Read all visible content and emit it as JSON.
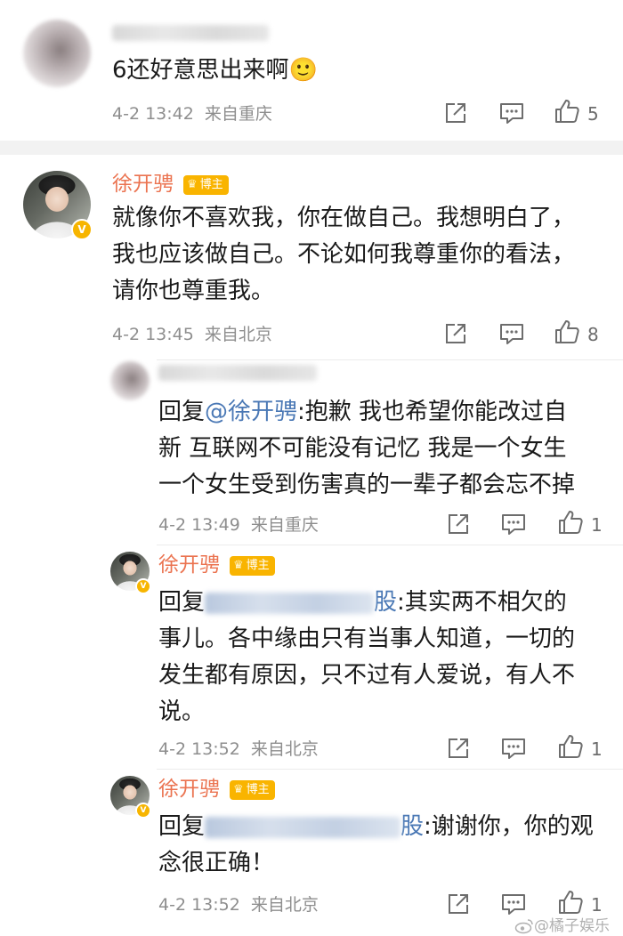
{
  "comments": [
    {
      "user": {
        "name": "",
        "blurred": true
      },
      "text_lines": [
        "6还好意思出来啊"
      ],
      "emoji": "🙂",
      "time": "4-2 13:42",
      "location": "来自重庆",
      "likes": "5"
    },
    {
      "user": {
        "name": "徐开骋",
        "badge": "博主",
        "verified": "V"
      },
      "text_lines": [
        "就像你不喜欢我，你在做自己。我想明白了，",
        "我也应该做自己。不论如何我尊重你的看法，",
        "请你也尊重我。"
      ],
      "time": "4-2 13:45",
      "location": "来自北京",
      "likes": "8"
    }
  ],
  "replies": [
    {
      "user": {
        "name": "",
        "blurred": true
      },
      "prefix": "回复",
      "mention": "@徐开骋",
      "line1_rest": ":抱歉 我也希望你能改过自",
      "more_lines": [
        "新 互联网不可能没有记忆 我是一个女生",
        "一个女生受到伤害真的一辈子都会忘不掉"
      ],
      "time": "4-2 13:49",
      "location": "来自重庆",
      "likes": "1"
    },
    {
      "user": {
        "name": "徐开骋",
        "badge": "博主",
        "verified": "V"
      },
      "prefix": "回复",
      "mention_tail": "股",
      "line1_rest": ":其实两不相欠的",
      "more_lines": [
        "事儿。各中缘由只有当事人知道，一切的",
        "发生都有原因，只不过有人爱说，有人不",
        "说。"
      ],
      "time": "4-2 13:52",
      "location": "来自北京",
      "likes": "1"
    },
    {
      "user": {
        "name": "徐开骋",
        "badge": "博主",
        "verified": "V"
      },
      "prefix": "回复",
      "mention_tail": "股",
      "line1_rest": ":谢谢你，你的观",
      "more_lines": [
        "念很正确！"
      ],
      "time": "4-2 13:52",
      "location": "来自北京",
      "likes": "1"
    }
  ],
  "watermark": "@橘子娱乐",
  "icons": {
    "share": "share-icon",
    "comment": "comment-icon",
    "like": "like-icon",
    "weibo": "weibo-logo-icon"
  },
  "colors": {
    "name_orange": "#eb7350",
    "mention_blue": "#4a78b5",
    "badge_gold": "#f9b400",
    "meta_gray": "#8e8e8e"
  }
}
